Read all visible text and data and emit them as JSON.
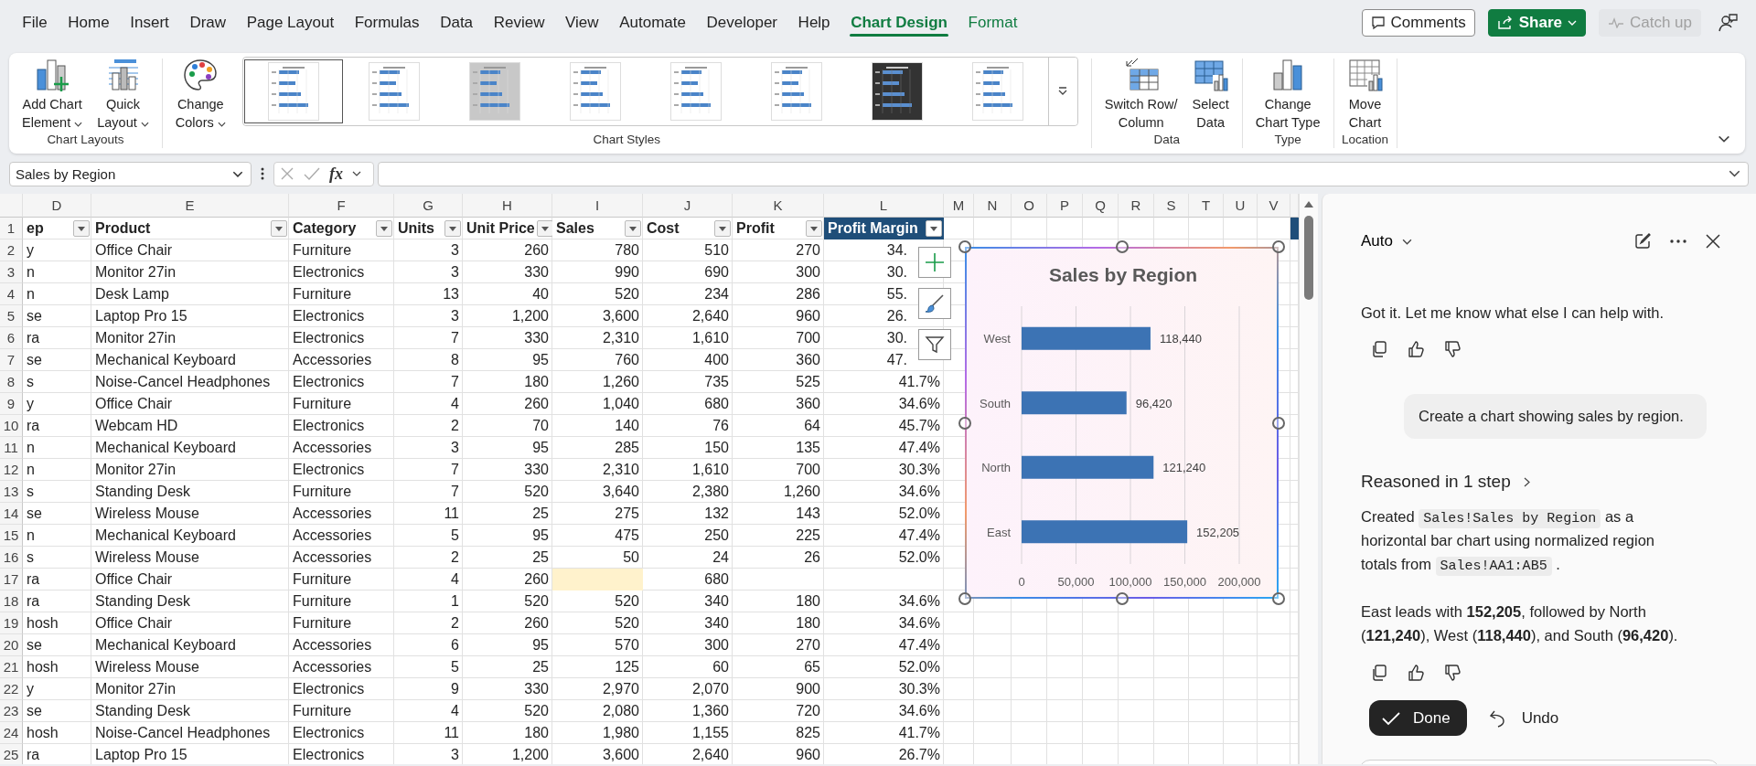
{
  "menu_tabs": [
    {
      "label": "File",
      "selected": false,
      "contextual": false
    },
    {
      "label": "Home",
      "selected": false,
      "contextual": false
    },
    {
      "label": "Insert",
      "selected": false,
      "contextual": false
    },
    {
      "label": "Draw",
      "selected": false,
      "contextual": false
    },
    {
      "label": "Page Layout",
      "selected": false,
      "contextual": false
    },
    {
      "label": "Formulas",
      "selected": false,
      "contextual": false
    },
    {
      "label": "Data",
      "selected": false,
      "contextual": false
    },
    {
      "label": "Review",
      "selected": false,
      "contextual": false
    },
    {
      "label": "View",
      "selected": false,
      "contextual": false
    },
    {
      "label": "Automate",
      "selected": false,
      "contextual": false
    },
    {
      "label": "Developer",
      "selected": false,
      "contextual": false
    },
    {
      "label": "Help",
      "selected": false,
      "contextual": false
    },
    {
      "label": "Chart Design",
      "selected": true,
      "contextual": true
    },
    {
      "label": "Format",
      "selected": false,
      "contextual": true
    }
  ],
  "header_buttons": [
    {
      "kind": "comments",
      "label": "Comments",
      "disabled": false
    },
    {
      "kind": "share",
      "label": "Share",
      "disabled": false
    },
    {
      "kind": "catch_up",
      "label": "Catch up",
      "disabled": true
    }
  ],
  "ribbon": {
    "groups": [
      {
        "label": "Chart Layouts",
        "commands": [
          {
            "kind": "add_chart_element",
            "lines": [
              "Add Chart",
              "Element"
            ],
            "dropdown": true
          },
          {
            "kind": "quick_layout",
            "lines": [
              "Quick",
              "Layout"
            ],
            "dropdown": true
          }
        ]
      },
      {
        "label": "Chart Styles",
        "commands": [
          {
            "kind": "change_colors",
            "lines": [
              "Change",
              "Colors"
            ],
            "dropdown": true
          }
        ],
        "gallery": [
          {
            "kind": "light",
            "selected": true
          },
          {
            "kind": "light",
            "selected": false
          },
          {
            "kind": "gray",
            "selected": false
          },
          {
            "kind": "light",
            "selected": false
          },
          {
            "kind": "light",
            "selected": false
          },
          {
            "kind": "light",
            "selected": false
          },
          {
            "kind": "dark",
            "selected": false
          },
          {
            "kind": "light",
            "selected": false
          }
        ]
      },
      {
        "label": "Data",
        "commands": [
          {
            "kind": "switch_row_column",
            "lines": [
              "Switch Row/",
              "Column"
            ],
            "dropdown": false
          },
          {
            "kind": "select_data",
            "lines": [
              "Select",
              "Data"
            ],
            "dropdown": false
          }
        ]
      },
      {
        "label": "Type",
        "commands": [
          {
            "kind": "change_chart_type",
            "lines": [
              "Change",
              "Chart Type"
            ],
            "dropdown": false
          }
        ]
      },
      {
        "label": "Location",
        "commands": [
          {
            "kind": "move_chart",
            "lines": [
              "Move",
              "Chart"
            ],
            "dropdown": false
          }
        ]
      }
    ]
  },
  "formula_bar": {
    "name_box": "Sales by Region",
    "function_label": "fx"
  },
  "grid": {
    "column_letters": [
      "D",
      "E",
      "F",
      "G",
      "H",
      "I",
      "J",
      "K",
      "L",
      "M",
      "N",
      "O",
      "P",
      "Q",
      "R",
      "S",
      "T",
      "U",
      "V"
    ],
    "header_row": "1",
    "table_columns": [
      {
        "header": "ep",
        "highlighted": false
      },
      {
        "header": "Product",
        "highlighted": false
      },
      {
        "header": "Category",
        "highlighted": false
      },
      {
        "header": "Units",
        "highlighted": false
      },
      {
        "header": "Unit Price",
        "highlighted": false
      },
      {
        "header": "Sales",
        "highlighted": false
      },
      {
        "header": "Cost",
        "highlighted": false
      },
      {
        "header": "Profit",
        "highlighted": false
      },
      {
        "header": "Profit Margin",
        "highlighted": true
      }
    ],
    "rows": [
      {
        "number": "2",
        "sales_highlighted": false,
        "cells": [
          "y",
          "Office Chair",
          "Furniture",
          "3",
          "260",
          "780",
          "510",
          "270",
          "34."
        ]
      },
      {
        "number": "3",
        "sales_highlighted": false,
        "cells": [
          "n",
          "Monitor 27in",
          "Electronics",
          "3",
          "330",
          "990",
          "690",
          "300",
          "30."
        ]
      },
      {
        "number": "4",
        "sales_highlighted": false,
        "cells": [
          "n",
          "Desk Lamp",
          "Furniture",
          "13",
          "40",
          "520",
          "234",
          "286",
          "55."
        ]
      },
      {
        "number": "5",
        "sales_highlighted": false,
        "cells": [
          "se",
          "Laptop Pro 15",
          "Electronics",
          "3",
          "1,200",
          "3,600",
          "2,640",
          "960",
          "26."
        ]
      },
      {
        "number": "6",
        "sales_highlighted": false,
        "cells": [
          "ra",
          "Monitor 27in",
          "Electronics",
          "7",
          "330",
          "2,310",
          "1,610",
          "700",
          "30."
        ]
      },
      {
        "number": "7",
        "sales_highlighted": false,
        "cells": [
          "se",
          "Mechanical Keyboard",
          "Accessories",
          "8",
          "95",
          "760",
          "400",
          "360",
          "47."
        ]
      },
      {
        "number": "8",
        "sales_highlighted": false,
        "cells": [
          "s",
          "Noise-Cancel Headphones",
          "Electronics",
          "7",
          "180",
          "1,260",
          "735",
          "525",
          "41.7%"
        ]
      },
      {
        "number": "9",
        "sales_highlighted": false,
        "cells": [
          "y",
          "Office Chair",
          "Furniture",
          "4",
          "260",
          "1,040",
          "680",
          "360",
          "34.6%"
        ]
      },
      {
        "number": "10",
        "sales_highlighted": false,
        "cells": [
          "ra",
          "Webcam HD",
          "Electronics",
          "2",
          "70",
          "140",
          "76",
          "64",
          "45.7%"
        ]
      },
      {
        "number": "11",
        "sales_highlighted": false,
        "cells": [
          "n",
          "Mechanical Keyboard",
          "Accessories",
          "3",
          "95",
          "285",
          "150",
          "135",
          "47.4%"
        ]
      },
      {
        "number": "12",
        "sales_highlighted": false,
        "cells": [
          "n",
          "Monitor 27in",
          "Electronics",
          "7",
          "330",
          "2,310",
          "1,610",
          "700",
          "30.3%"
        ]
      },
      {
        "number": "13",
        "sales_highlighted": false,
        "cells": [
          "s",
          "Standing Desk",
          "Furniture",
          "7",
          "520",
          "3,640",
          "2,380",
          "1,260",
          "34.6%"
        ]
      },
      {
        "number": "14",
        "sales_highlighted": false,
        "cells": [
          "se",
          "Wireless Mouse",
          "Accessories",
          "11",
          "25",
          "275",
          "132",
          "143",
          "52.0%"
        ]
      },
      {
        "number": "15",
        "sales_highlighted": false,
        "cells": [
          "n",
          "Mechanical Keyboard",
          "Accessories",
          "5",
          "95",
          "475",
          "250",
          "225",
          "47.4%"
        ]
      },
      {
        "number": "16",
        "sales_highlighted": false,
        "cells": [
          "s",
          "Wireless Mouse",
          "Accessories",
          "2",
          "25",
          "50",
          "24",
          "26",
          "52.0%"
        ]
      },
      {
        "number": "17",
        "sales_highlighted": true,
        "cells": [
          "ra",
          "Office Chair",
          "Furniture",
          "4",
          "260",
          null,
          "680",
          null,
          null
        ]
      },
      {
        "number": "18",
        "sales_highlighted": false,
        "cells": [
          "ra",
          "Standing Desk",
          "Furniture",
          "1",
          "520",
          "520",
          "340",
          "180",
          "34.6%"
        ]
      },
      {
        "number": "19",
        "sales_highlighted": false,
        "cells": [
          "hosh",
          "Office Chair",
          "Furniture",
          "2",
          "260",
          "520",
          "340",
          "180",
          "34.6%"
        ]
      },
      {
        "number": "20",
        "sales_highlighted": false,
        "cells": [
          "se",
          "Mechanical Keyboard",
          "Accessories",
          "6",
          "95",
          "570",
          "300",
          "270",
          "47.4%"
        ]
      },
      {
        "number": "21",
        "sales_highlighted": false,
        "cells": [
          "hosh",
          "Wireless Mouse",
          "Accessories",
          "5",
          "25",
          "125",
          "60",
          "65",
          "52.0%"
        ]
      },
      {
        "number": "22",
        "sales_highlighted": false,
        "cells": [
          "y",
          "Monitor 27in",
          "Electronics",
          "9",
          "330",
          "2,970",
          "2,070",
          "900",
          "30.3%"
        ]
      },
      {
        "number": "23",
        "sales_highlighted": false,
        "cells": [
          "se",
          "Standing Desk",
          "Furniture",
          "4",
          "520",
          "2,080",
          "1,360",
          "720",
          "34.6%"
        ]
      },
      {
        "number": "24",
        "sales_highlighted": false,
        "cells": [
          "hosh",
          "Noise-Cancel Headphones",
          "Electronics",
          "11",
          "180",
          "1,980",
          "1,155",
          "825",
          "41.7%"
        ]
      },
      {
        "number": "25",
        "sales_highlighted": false,
        "cells": [
          "ra",
          "Laptop Pro 15",
          "Electronics",
          "3",
          "1,200",
          "3,600",
          "2,640",
          "960",
          "26.7%"
        ]
      }
    ]
  },
  "chart": {
    "chart_data": {
      "type": "bar",
      "orientation": "horizontal",
      "title": "Sales by Region",
      "categories": [
        "West",
        "South",
        "North",
        "East"
      ],
      "series": [
        {
          "color": "#3c73b4",
          "values": [
            118440,
            96420,
            121240,
            152205
          ]
        }
      ],
      "xlim": [
        0,
        200000
      ],
      "xticks": [
        {
          "value": 0,
          "label": "0"
        },
        {
          "value": 50000,
          "label": "50,000"
        },
        {
          "value": 100000,
          "label": "100,000"
        },
        {
          "value": 150000,
          "label": "150,000"
        },
        {
          "value": 200000,
          "label": "200,000"
        }
      ],
      "value_labels": [
        "118,440",
        "96,420",
        "121,240",
        "152,205"
      ],
      "grid": true
    }
  },
  "copilot": {
    "mode": "Auto",
    "messages": [
      {
        "kind": "assistant",
        "text": "Got it. Let me know what else I can help with.",
        "feedback": true
      },
      {
        "kind": "user",
        "text": "Create a chart showing sales by region.",
        "feedback": false
      },
      {
        "kind": "reasoning",
        "text": "Reasoned in 1 step",
        "feedback": false
      },
      {
        "kind": "assistant_parts",
        "feedback": false,
        "parts": [
          {
            "kind": "text",
            "text": "Created "
          },
          {
            "kind": "code",
            "text": "Sales!Sales by Region"
          },
          {
            "kind": "text",
            "text": " as a horizontal bar chart using normalized region totals from "
          },
          {
            "kind": "code",
            "text": "Sales!AA1:AB5"
          },
          {
            "kind": "text",
            "text": " ."
          }
        ]
      },
      {
        "kind": "assistant",
        "text": "East leads with **152,205**, followed by North (**121,240**), West (**118,440**), and South (**96,420**).",
        "feedback": true
      }
    ],
    "actions": [
      {
        "kind": "done",
        "label": "Done"
      },
      {
        "kind": "undo",
        "label": "Undo"
      }
    ]
  }
}
